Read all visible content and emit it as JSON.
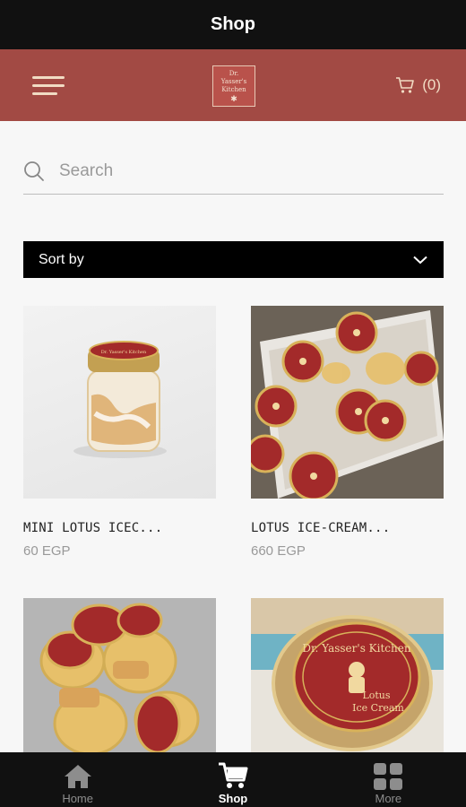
{
  "window": {
    "title": "Shop"
  },
  "header": {
    "logo_text": "Dr. Yasser's Kitchen",
    "cart_count": "(0)",
    "brand_color": "#a24a44"
  },
  "search": {
    "placeholder": "Search"
  },
  "sort": {
    "label": "Sort by"
  },
  "products": [
    {
      "name": "MINI LOTUS ICEC...",
      "price": "60 EGP"
    },
    {
      "name": "LOTUS ICE-CREAM...",
      "price": "660 EGP"
    },
    {
      "name": "",
      "price": ""
    },
    {
      "name": "",
      "price": ""
    }
  ],
  "jar_labels": {
    "brand": "Dr. Yasser's Kitchen",
    "line1": "Lotus",
    "line2": "Ice Cream"
  },
  "bottom_nav": [
    {
      "label": "Home",
      "icon": "home-icon"
    },
    {
      "label": "Shop",
      "icon": "cart-icon",
      "active": true
    },
    {
      "label": "More",
      "icon": "grid-icon"
    }
  ]
}
